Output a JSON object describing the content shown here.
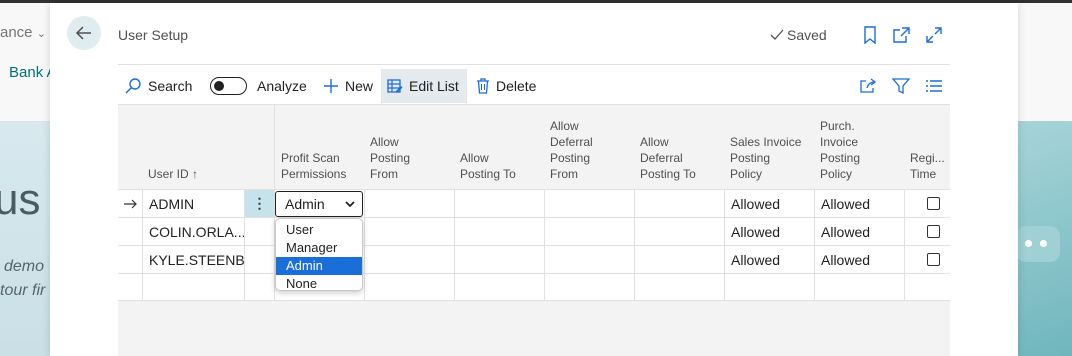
{
  "background": {
    "nav_item_1": "ance",
    "nav_item_2": "Bank A",
    "hero_title": "us",
    "hero_text_1": "demo",
    "hero_text_2": "tour fir"
  },
  "dialog": {
    "title": "User Setup",
    "saved_label": "Saved"
  },
  "actions": {
    "search": "Search",
    "analyze": "Analyze",
    "new": "New",
    "edit_list": "Edit List",
    "delete": "Delete"
  },
  "columns": {
    "user_id": "User ID ↑",
    "profit_scan": "Profit Scan Permissions",
    "allow_posting_from": "Allow Posting From",
    "allow_posting_to": "Allow Posting To",
    "allow_deferral_from": "Allow Deferral Posting From",
    "allow_deferral_to": "Allow Deferral Posting To",
    "sales_invoice_policy": "Sales Invoice Posting Policy",
    "purch_invoice_policy": "Purch. Invoice Posting Policy",
    "register_time": "Regi... Time"
  },
  "rows": [
    {
      "user_id": "ADMIN",
      "sales_policy": "Allowed",
      "purch_policy": "Allowed"
    },
    {
      "user_id": "COLIN.ORLA...",
      "sales_policy": "Allowed",
      "purch_policy": "Allowed"
    },
    {
      "user_id": "KYLE.STEENB...",
      "sales_policy": "Allowed",
      "purch_policy": "Allowed"
    }
  ],
  "select": {
    "value": "Admin",
    "options": [
      "User",
      "Manager",
      "Admin",
      "None"
    ]
  },
  "colors": {
    "accent": "#1a6ed8",
    "dots_cell": "#c6e3ec",
    "back_button": "#dfecf0"
  }
}
